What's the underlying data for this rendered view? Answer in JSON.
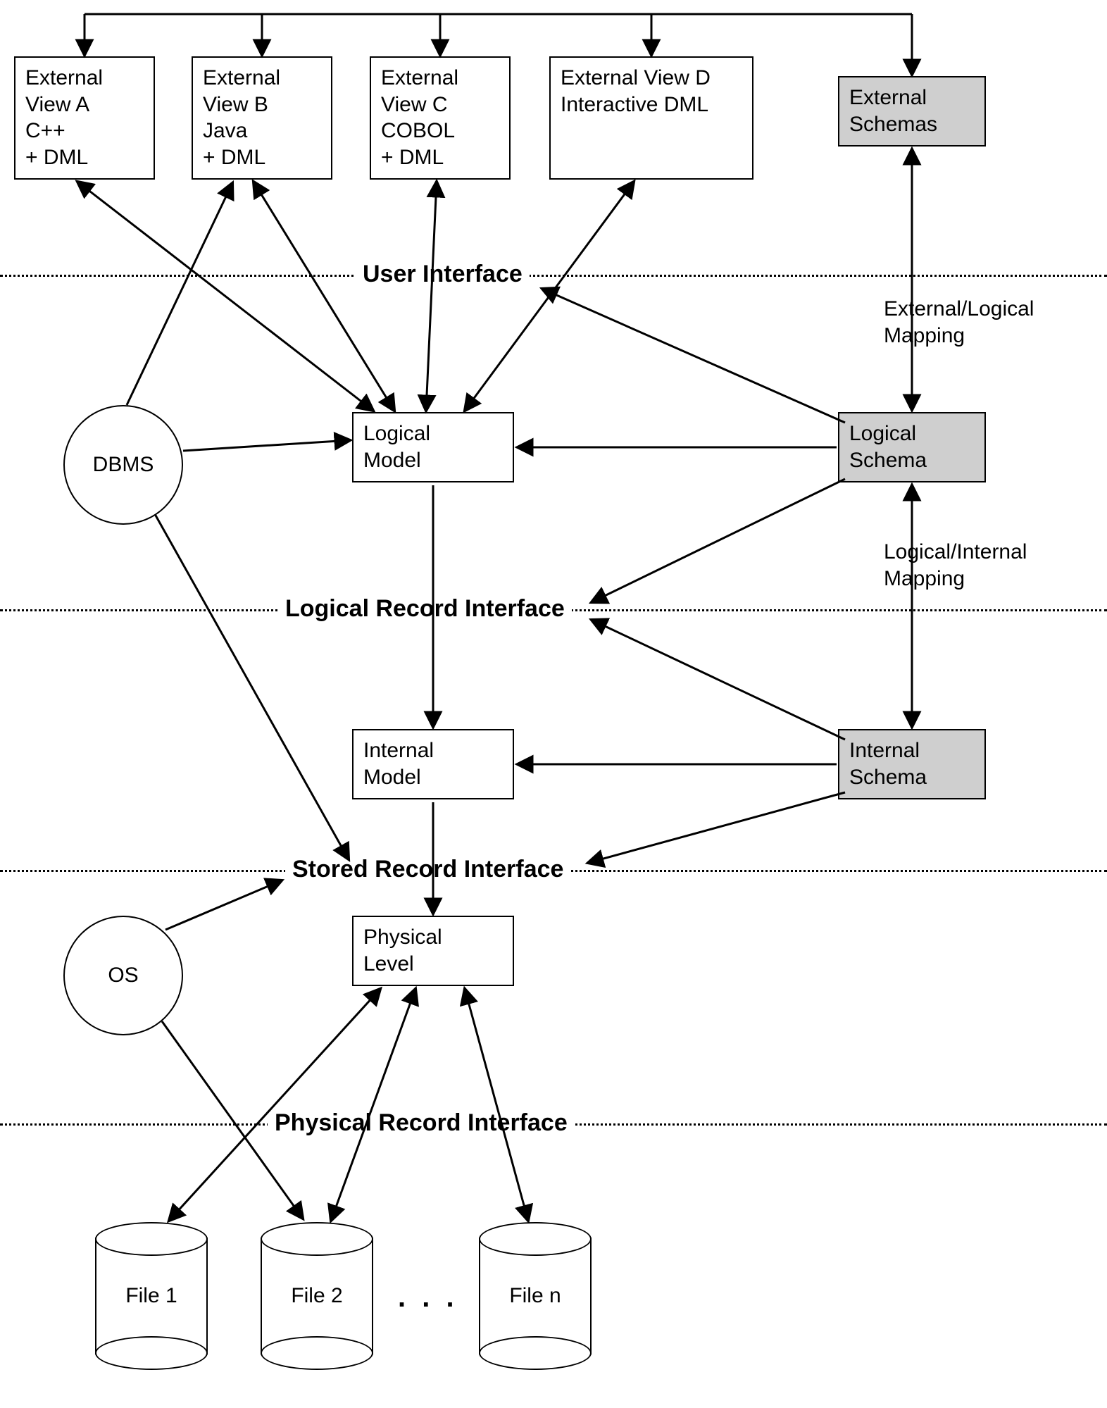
{
  "views": {
    "a": "External\nView A\nC++\n+ DML",
    "b": "External\nView B\nJava\n+ DML",
    "c": "External\nView C\nCOBOL\n+ DML",
    "d": "External View D\nInteractive DML"
  },
  "schemas": {
    "external": "External\nSchemas",
    "logical": "Logical\nSchema",
    "internal": "Internal\nSchema"
  },
  "models": {
    "logical": "Logical\nModel",
    "internal": "Internal\nModel",
    "physical": "Physical\nLevel"
  },
  "circles": {
    "dbms": "DBMS",
    "os": "OS"
  },
  "mappings": {
    "ext_log": "External/Logical\nMapping",
    "log_int": "Logical/Internal\nMapping"
  },
  "interfaces": {
    "ui": "User Interface",
    "lri": "Logical Record Interface",
    "sri": "Stored Record Interface",
    "pri": "Physical Record Interface"
  },
  "files": {
    "f1": "File 1",
    "f2": "File 2",
    "fn": "File n"
  },
  "ellipsis": ". . ."
}
